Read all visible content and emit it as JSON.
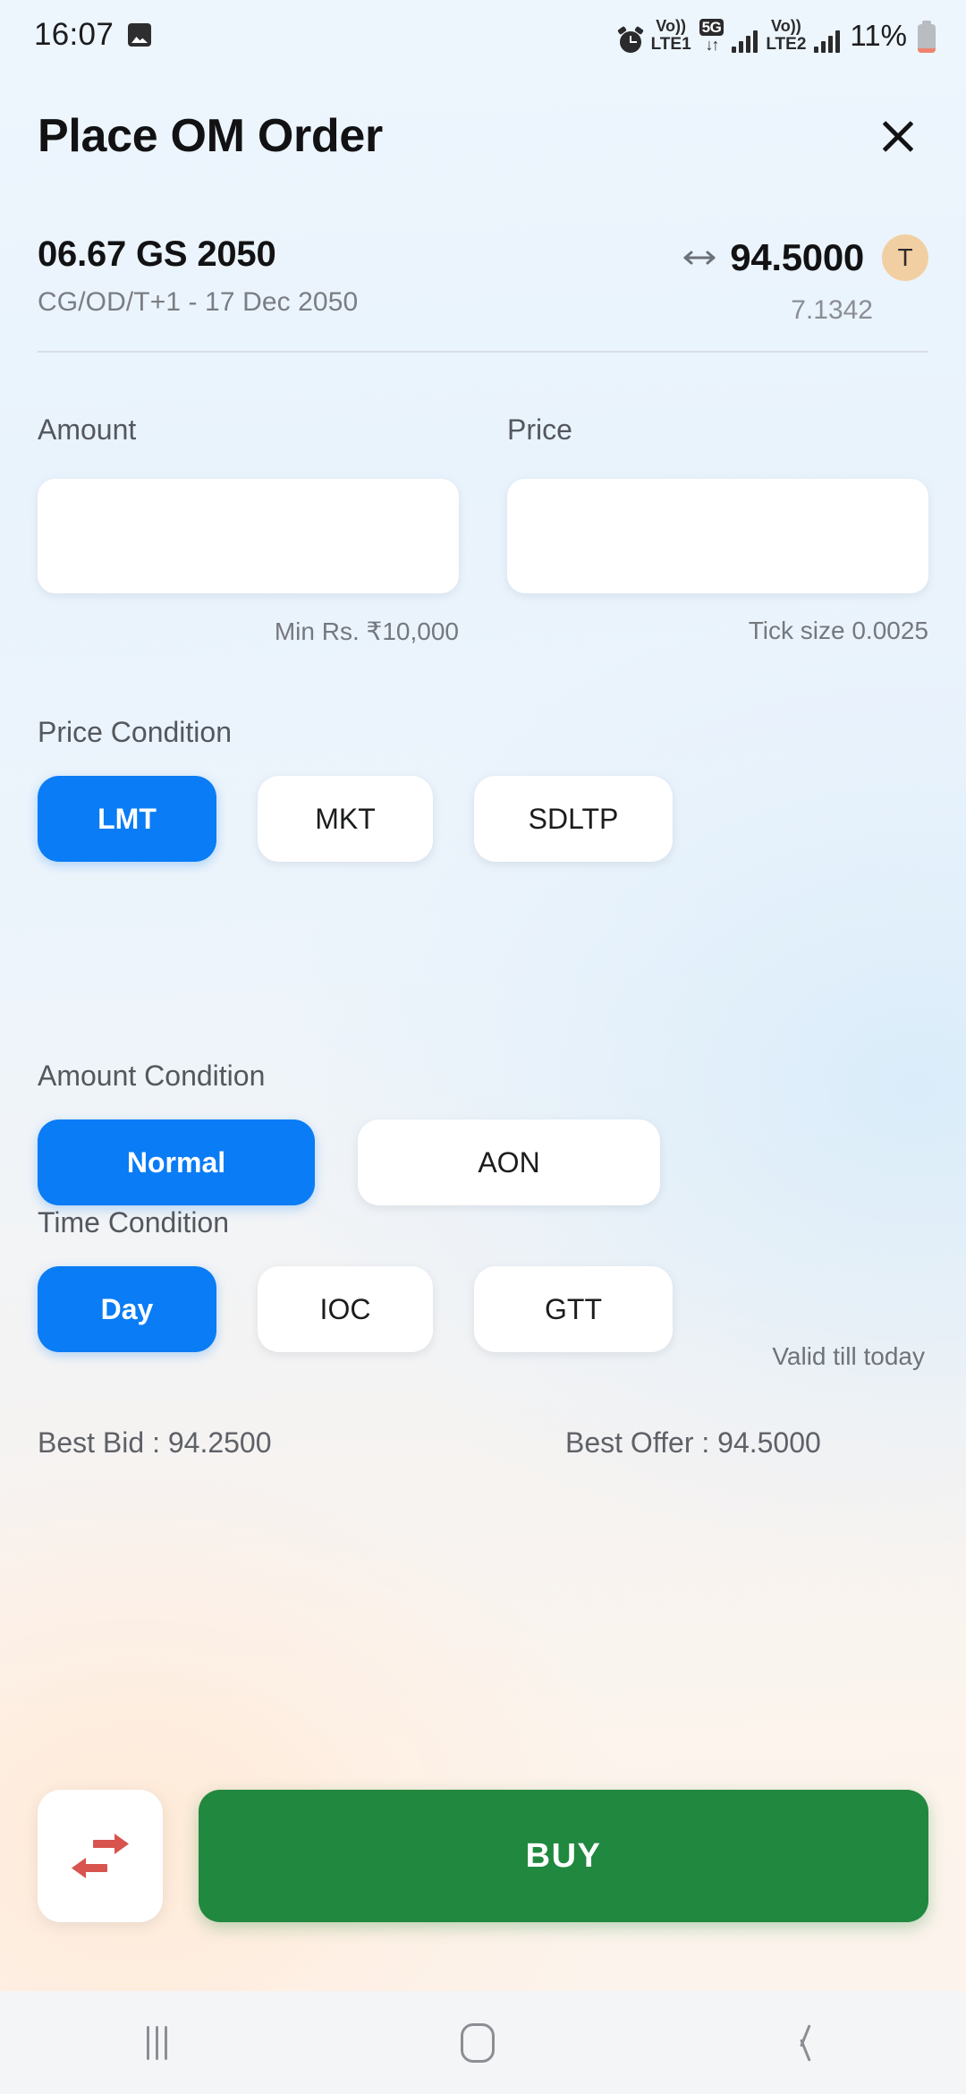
{
  "status_bar": {
    "time": "16:07",
    "photo_icon": "image-icon",
    "alarm_icon": "alarm-icon",
    "volte1_top": "Vo))",
    "volte1_bottom": "LTE1",
    "network_tag": "5G",
    "network_arrows": "↓↑",
    "volte2_top": "Vo))",
    "volte2_bottom": "LTE2",
    "battery_percent": "11%"
  },
  "header": {
    "title": "Place OM Order",
    "close_icon": "close-icon"
  },
  "security": {
    "name": "06.67 GS 2050",
    "subtitle": "CG/OD/T+1 - 17 Dec 2050",
    "price_arrow_icon": "left-right-arrow-icon",
    "price": "94.5000",
    "badge": "T",
    "badge_color": "#f2cfa2",
    "yield": "7.1342"
  },
  "amount_field": {
    "label": "Amount",
    "value": "",
    "placeholder": "",
    "hint": "Min Rs. ₹10,000"
  },
  "price_field": {
    "label": "Price",
    "value": "",
    "placeholder": "",
    "hint": "Tick size 0.0025"
  },
  "price_condition": {
    "label": "Price Condition",
    "options": [
      {
        "label": "LMT",
        "selected": true
      },
      {
        "label": "MKT",
        "selected": false
      },
      {
        "label": "SDLTP",
        "selected": false
      }
    ]
  },
  "amount_condition": {
    "label": "Amount Condition",
    "options": [
      {
        "label": "Normal",
        "selected": true
      },
      {
        "label": "AON",
        "selected": false
      }
    ]
  },
  "time_condition": {
    "label": "Time Condition",
    "options": [
      {
        "label": "Day",
        "selected": true
      },
      {
        "label": "IOC",
        "selected": false
      },
      {
        "label": "GTT",
        "selected": false
      }
    ],
    "note": "Valid till today"
  },
  "market": {
    "best_bid": "Best Bid : 94.2500",
    "best_offer": "Best Offer : 94.5000"
  },
  "actions": {
    "swap_icon": "swap-arrows-icon",
    "swap_icon_color": "#d8544f",
    "buy_label": "BUY",
    "buy_color": "#21883f"
  },
  "nav_bar": {
    "recents_icon": "recents-icon",
    "home_icon": "home-icon",
    "back_icon": "back-chevron-icon"
  },
  "theme": {
    "accent_blue": "#0a7cf5",
    "buy_green": "#21883f",
    "swap_red": "#d8544f",
    "badge_tan": "#f2cfa2"
  }
}
